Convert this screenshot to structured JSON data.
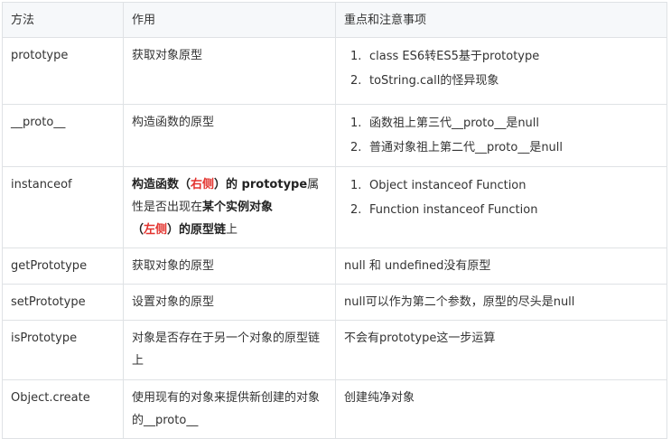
{
  "table": {
    "headers": [
      "方法",
      "作用",
      "重点和注意事项"
    ],
    "rows": [
      {
        "method": "prototype",
        "purpose": "获取对象原型",
        "notes": [
          {
            "num": "1.",
            "text": "class ES6转ES5基于prototype"
          },
          {
            "num": "2.",
            "text": "toString.call的怪异现象"
          }
        ]
      },
      {
        "method": "__proto__",
        "purpose": "构造函数的原型",
        "notes": [
          {
            "num": "1.",
            "text": "函数祖上第三代__proto__是null"
          },
          {
            "num": "2.",
            "text": "普通对象祖上第二代__proto__是null"
          }
        ]
      },
      {
        "method": "instanceof",
        "purpose_parts": {
          "p1": "构造函数（",
          "p2": "右侧",
          "p3": "）的 prototype",
          "p4": "属性是否出现在",
          "p5": "某个实例对象",
          "p6": "（",
          "p7": "左侧",
          "p8": "）的原型链",
          "p9": "上"
        },
        "notes": [
          {
            "num": "1.",
            "text": "Object instanceof Function"
          },
          {
            "num": "2.",
            "text": "Function instanceof Function"
          }
        ]
      },
      {
        "method": "getPrototype",
        "purpose": "获取对象的原型",
        "note": "null 和 undefined没有原型"
      },
      {
        "method": "setPrototype",
        "purpose": "设置对象的原型",
        "note": "null可以作为第二个参数，原型的尽头是null"
      },
      {
        "method": "isPrototype",
        "purpose": "对象是否存在于另一个对象的原型链上",
        "note": "不会有prototype这一步运算"
      },
      {
        "method": "Object.create",
        "purpose": "使用现有的对象来提供新创建的对象的__proto__",
        "note": "创建纯净对象"
      }
    ]
  },
  "colors": {
    "border": "#dfe2e5",
    "header_bg": "#f6f8fa",
    "text": "#333333",
    "highlight": "#e3342f"
  }
}
